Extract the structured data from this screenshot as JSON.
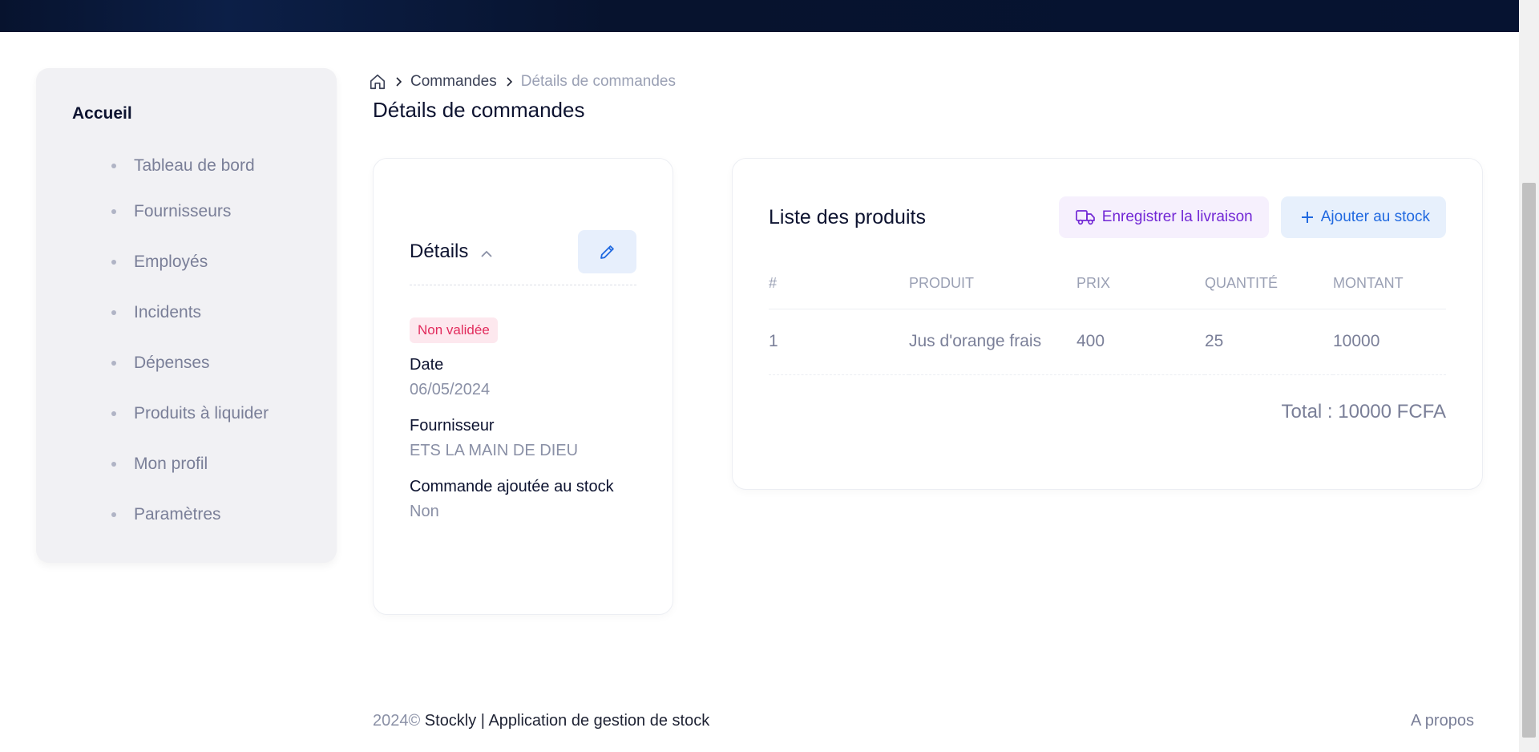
{
  "sidebar": {
    "title": "Accueil",
    "items": [
      {
        "label": "Tableau de bord"
      },
      {
        "label": "Fournisseurs"
      },
      {
        "label": "Employés"
      },
      {
        "label": "Incidents"
      },
      {
        "label": "Dépenses"
      },
      {
        "label": "Produits à liquider"
      },
      {
        "label": "Mon profil"
      },
      {
        "label": "Paramètres"
      }
    ]
  },
  "breadcrumb": {
    "home_icon": "home-icon",
    "parent": "Commandes",
    "current": "Détails de commandes"
  },
  "page_title": "Détails de commandes",
  "details": {
    "title": "Détails",
    "status_badge": "Non validée",
    "date_label": "Date",
    "date_value": "06/05/2024",
    "supplier_label": "Fournisseur",
    "supplier_value": "ETS LA MAIN DE DIEU",
    "stock_label": "Commande ajoutée au stock",
    "stock_value": "Non"
  },
  "products": {
    "title": "Liste des produits",
    "delivery_button": "Enregistrer la livraison",
    "add_stock_button": "Ajouter au stock",
    "columns": [
      "#",
      "PRODUIT",
      "PRIX",
      "QUANTITÉ",
      "MONTANT"
    ],
    "rows": [
      {
        "num": "1",
        "product": "Jus d'orange frais",
        "price": "400",
        "qty": "25",
        "amount": "10000"
      }
    ],
    "total": "Total : 10000 FCFA"
  },
  "footer": {
    "year": "2024©",
    "text": " Stockly | Application de gestion de stock",
    "about": "A propos"
  },
  "colors": {
    "topbar": "#07132e",
    "badge_text": "#e22c5d",
    "delivery_accent": "#7228d5",
    "stock_accent": "#2069e0"
  }
}
